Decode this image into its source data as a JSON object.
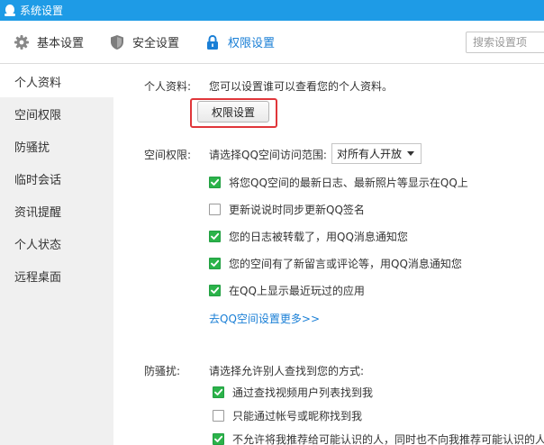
{
  "window": {
    "title": "系统设置"
  },
  "toolbar": {
    "tabs": [
      {
        "label": "基本设置",
        "icon": "gear-icon"
      },
      {
        "label": "安全设置",
        "icon": "shield-icon"
      },
      {
        "label": "权限设置",
        "icon": "lock-icon"
      }
    ],
    "search_placeholder": "搜索设置项"
  },
  "sidebar": {
    "items": [
      {
        "label": "个人资料"
      },
      {
        "label": "空间权限"
      },
      {
        "label": "防骚扰"
      },
      {
        "label": "临时会话"
      },
      {
        "label": "资讯提醒"
      },
      {
        "label": "个人状态"
      },
      {
        "label": "远程桌面"
      }
    ]
  },
  "profile": {
    "label": "个人资料:",
    "description": "您可以设置谁可以查看您的个人资料。",
    "button_label": "权限设置"
  },
  "space": {
    "label": "空间权限:",
    "scope_prompt": "请选择QQ空间访问范围:",
    "scope_value": "对所有人开放",
    "options": [
      {
        "label": "将您QQ空间的最新日志、最新照片等显示在QQ上",
        "checked": true
      },
      {
        "label": "更新说说时同步更新QQ签名",
        "checked": false
      },
      {
        "label": "您的日志被转载了，用QQ消息通知您",
        "checked": true
      },
      {
        "label": "您的空间有了新留言或评论等，用QQ消息通知您",
        "checked": true
      },
      {
        "label": "在QQ上显示最近玩过的应用",
        "checked": true
      }
    ],
    "more_link": "去QQ空间设置更多>>"
  },
  "harass": {
    "label": "防骚扰:",
    "prompt": "请选择允许别人查找到您的方式:",
    "options": [
      {
        "label": "通过查找视频用户列表找到我",
        "checked": true
      },
      {
        "label": "只能通过帐号或昵称找到我",
        "checked": false
      },
      {
        "label": "不允许将我推荐给可能认识的人，同时也不向我推荐可能认识的人",
        "checked": true
      }
    ]
  },
  "colors": {
    "accent": "#1e9be6",
    "highlight": "#e0363a",
    "check": "#2bb34a",
    "link": "#1a7fd6"
  }
}
